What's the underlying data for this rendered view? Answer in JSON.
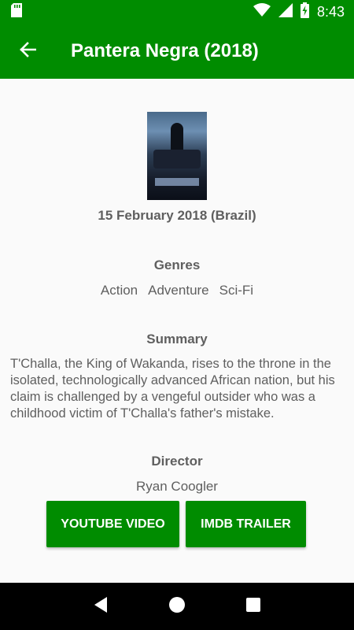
{
  "status_bar": {
    "time": "8:43",
    "icons": [
      "sd-card-icon",
      "wifi-icon",
      "signal-icon",
      "battery-charging-icon"
    ]
  },
  "app_bar": {
    "title": "Pantera Negra (2018)",
    "back_icon": "arrow-left-icon"
  },
  "movie": {
    "release": "15 February 2018 (Brazil)",
    "genres_label": "Genres",
    "genres": [
      "Action",
      "Adventure",
      "Sci-Fi"
    ],
    "summary_label": "Summary",
    "summary": "T'Challa, the King of Wakanda, rises to the throne in the isolated, technologically advanced African nation, but his claim is challenged by a vengeful outsider who was a childhood victim of T'Challa's father's mistake.",
    "director_label": "Director",
    "director": "Ryan Coogler"
  },
  "buttons": {
    "youtube": "YOUTUBE VIDEO",
    "imdb": "IMDB TRAILER"
  },
  "nav_bar": {
    "icons": [
      "back-triangle-icon",
      "home-circle-icon",
      "recents-square-icon"
    ]
  },
  "colors": {
    "primary": "#008c00",
    "text": "#5f5f5f",
    "background": "#fafafa"
  }
}
